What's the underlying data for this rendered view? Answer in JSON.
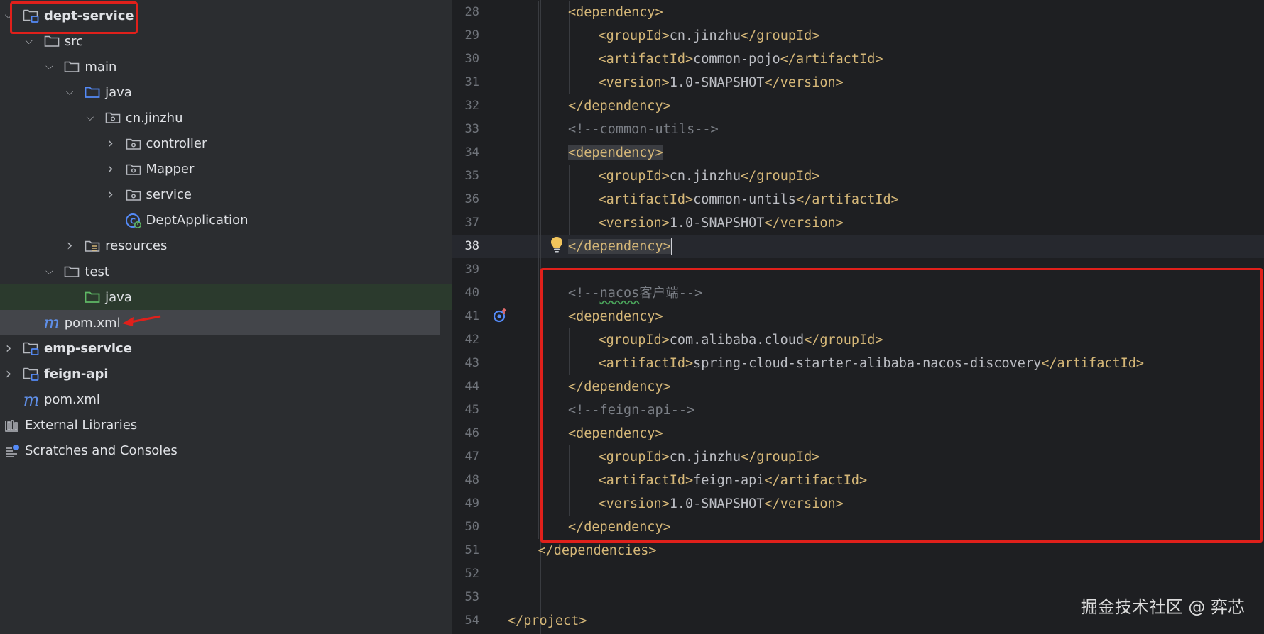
{
  "project_tree": [
    {
      "depth": 0,
      "arrow": "open",
      "icon": "module-folder-icon",
      "label": "dept-service",
      "bold": true
    },
    {
      "depth": 1,
      "arrow": "open",
      "icon": "folder-icon",
      "label": "src"
    },
    {
      "depth": 2,
      "arrow": "open",
      "icon": "folder-icon",
      "label": "main"
    },
    {
      "depth": 3,
      "arrow": "open",
      "icon": "source-folder-icon",
      "label": "java"
    },
    {
      "depth": 4,
      "arrow": "open",
      "icon": "package-icon",
      "label": "cn.jinzhu"
    },
    {
      "depth": 5,
      "arrow": "closed",
      "icon": "package-icon",
      "label": "controller"
    },
    {
      "depth": 5,
      "arrow": "closed",
      "icon": "package-icon",
      "label": "Mapper"
    },
    {
      "depth": 5,
      "arrow": "closed",
      "icon": "package-icon",
      "label": "service"
    },
    {
      "depth": 5,
      "arrow": "none",
      "icon": "spring-boot-class-icon",
      "label": "DeptApplication"
    },
    {
      "depth": 3,
      "arrow": "closed",
      "icon": "resources-folder-icon",
      "label": "resources"
    },
    {
      "depth": 2,
      "arrow": "open",
      "icon": "folder-icon",
      "label": "test"
    },
    {
      "depth": 3,
      "arrow": "none",
      "icon": "test-source-folder-icon",
      "label": "java"
    },
    {
      "depth": 1,
      "arrow": "none",
      "icon": "maven-icon",
      "label": "pom.xml",
      "selected": true
    },
    {
      "depth": 0,
      "arrow": "closed",
      "icon": "module-folder-icon",
      "label": "emp-service",
      "bold": true
    },
    {
      "depth": 0,
      "arrow": "closed",
      "icon": "module-folder-icon",
      "label": "feign-api",
      "bold": true
    },
    {
      "depth": 0,
      "arrow": "none",
      "icon": "maven-icon",
      "label": "pom.xml"
    },
    {
      "depth": -1,
      "arrow": "none",
      "icon": "library-icon",
      "label": "External Libraries"
    },
    {
      "depth": -1,
      "arrow": "none",
      "icon": "scratches-icon",
      "label": "Scratches and Consoles"
    }
  ],
  "editor": {
    "current_line": 38,
    "lines": [
      {
        "n": 28,
        "indent": 2,
        "parts": [
          [
            "tag",
            "<dependency>"
          ]
        ]
      },
      {
        "n": 29,
        "indent": 3,
        "parts": [
          [
            "tag",
            "<groupId>"
          ],
          [
            "txt",
            "cn.jinzhu"
          ],
          [
            "tag",
            "</groupId>"
          ]
        ]
      },
      {
        "n": 30,
        "indent": 3,
        "parts": [
          [
            "tag",
            "<artifactId>"
          ],
          [
            "txt",
            "common-pojo"
          ],
          [
            "tag",
            "</artifactId>"
          ]
        ]
      },
      {
        "n": 31,
        "indent": 3,
        "parts": [
          [
            "tag",
            "<version>"
          ],
          [
            "txt",
            "1.0-SNAPSHOT"
          ],
          [
            "tag",
            "</version>"
          ]
        ]
      },
      {
        "n": 32,
        "indent": 2,
        "parts": [
          [
            "tag",
            "</dependency>"
          ]
        ]
      },
      {
        "n": 33,
        "indent": 2,
        "parts": [
          [
            "cmt",
            "<!--common-utils-->"
          ]
        ]
      },
      {
        "n": 34,
        "indent": 2,
        "parts": [
          [
            "tag-hl",
            "<dependency>"
          ]
        ]
      },
      {
        "n": 35,
        "indent": 3,
        "parts": [
          [
            "tag",
            "<groupId>"
          ],
          [
            "txt",
            "cn.jinzhu"
          ],
          [
            "tag",
            "</groupId>"
          ]
        ]
      },
      {
        "n": 36,
        "indent": 3,
        "parts": [
          [
            "tag",
            "<artifactId>"
          ],
          [
            "txt",
            "common-untils"
          ],
          [
            "tag",
            "</artifactId>"
          ]
        ]
      },
      {
        "n": 37,
        "indent": 3,
        "parts": [
          [
            "tag",
            "<version>"
          ],
          [
            "txt",
            "1.0-SNAPSHOT"
          ],
          [
            "tag",
            "</version>"
          ]
        ]
      },
      {
        "n": 38,
        "indent": 2,
        "parts": [
          [
            "tag-hl",
            "</dependency>"
          ],
          [
            "caret",
            ""
          ]
        ]
      },
      {
        "n": 39,
        "indent": 0,
        "parts": []
      },
      {
        "n": 40,
        "indent": 2,
        "parts": [
          [
            "cmt",
            "<!--"
          ],
          [
            "cmt-sq",
            "nacos"
          ],
          [
            "cmt",
            "客户端-->"
          ]
        ]
      },
      {
        "n": 41,
        "indent": 2,
        "parts": [
          [
            "tag",
            "<dependency>"
          ]
        ]
      },
      {
        "n": 42,
        "indent": 3,
        "parts": [
          [
            "tag",
            "<groupId>"
          ],
          [
            "txt",
            "com.alibaba.cloud"
          ],
          [
            "tag",
            "</groupId>"
          ]
        ]
      },
      {
        "n": 43,
        "indent": 3,
        "parts": [
          [
            "tag",
            "<artifactId>"
          ],
          [
            "txt",
            "spring-cloud-starter-alibaba-nacos-discovery"
          ],
          [
            "tag",
            "</artifactId>"
          ]
        ]
      },
      {
        "n": 44,
        "indent": 2,
        "parts": [
          [
            "tag",
            "</dependency>"
          ]
        ]
      },
      {
        "n": 45,
        "indent": 2,
        "parts": [
          [
            "cmt",
            "<!--feign-api-->"
          ]
        ]
      },
      {
        "n": 46,
        "indent": 2,
        "parts": [
          [
            "tag",
            "<dependency>"
          ]
        ]
      },
      {
        "n": 47,
        "indent": 3,
        "parts": [
          [
            "tag",
            "<groupId>"
          ],
          [
            "txt",
            "cn.jinzhu"
          ],
          [
            "tag",
            "</groupId>"
          ]
        ]
      },
      {
        "n": 48,
        "indent": 3,
        "parts": [
          [
            "tag",
            "<artifactId>"
          ],
          [
            "txt",
            "feign-api"
          ],
          [
            "tag",
            "</artifactId>"
          ]
        ]
      },
      {
        "n": 49,
        "indent": 3,
        "parts": [
          [
            "tag",
            "<version>"
          ],
          [
            "txt",
            "1.0-SNAPSHOT"
          ],
          [
            "tag",
            "</version>"
          ]
        ]
      },
      {
        "n": 50,
        "indent": 2,
        "parts": [
          [
            "tag",
            "</dependency>"
          ]
        ]
      },
      {
        "n": 51,
        "indent": 1,
        "parts": [
          [
            "tag",
            "</dependencies>"
          ]
        ]
      },
      {
        "n": 52,
        "indent": 0,
        "parts": []
      },
      {
        "n": 53,
        "indent": 0,
        "parts": []
      },
      {
        "n": 54,
        "indent": 0,
        "parts": [
          [
            "tag",
            "</project>"
          ]
        ]
      }
    ]
  },
  "watermark": "掘金技术社区 @ 弈芯",
  "colors": {
    "highlight_border": "#e0201b",
    "xml_tag": "#d5b778",
    "comment": "#7a7e85",
    "maven_icon": "#5f8fe8"
  }
}
